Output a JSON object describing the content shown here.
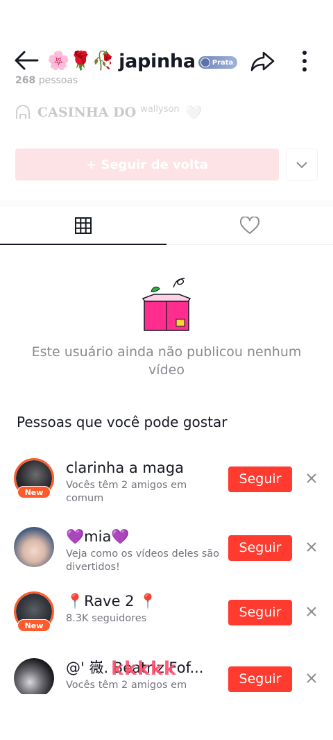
{
  "header": {
    "title_emoji": "🌸🌹🥀",
    "title_name": "japinha",
    "badge_label": "Prata",
    "followers_count": "268",
    "followers_label": "pessoas"
  },
  "bio": {
    "text": "CASINHA DO",
    "sup": "wallyson",
    "heart": "🤍"
  },
  "actions": {
    "follow_back_label": "+ Seguir de volta"
  },
  "empty_state": {
    "text": "Este usuário ainda não publicou nenhum vídeo"
  },
  "suggestions": {
    "title": "Pessoas que você pode gostar",
    "new_label": "New",
    "follow_label": "Seguir",
    "items": [
      {
        "name": "clarinha a maga",
        "sub": "Vocês têm 2 amigos em comum"
      },
      {
        "name": "💜mia💜",
        "sub": "Veja como os vídeos deles são divertidos!"
      },
      {
        "name": "📍Rave 2 📍",
        "sub": "8.3K seguidores"
      },
      {
        "name": "@' 嶶. Beatriz Fof...",
        "sub": "Vocês têm 2 amigos em"
      }
    ]
  },
  "overlay": {
    "watermark": "kkkkk"
  },
  "colors": {
    "accent": "#ff3b2f",
    "ring": "#fe5b2c",
    "follow_back_bg": "#fde3e5"
  }
}
